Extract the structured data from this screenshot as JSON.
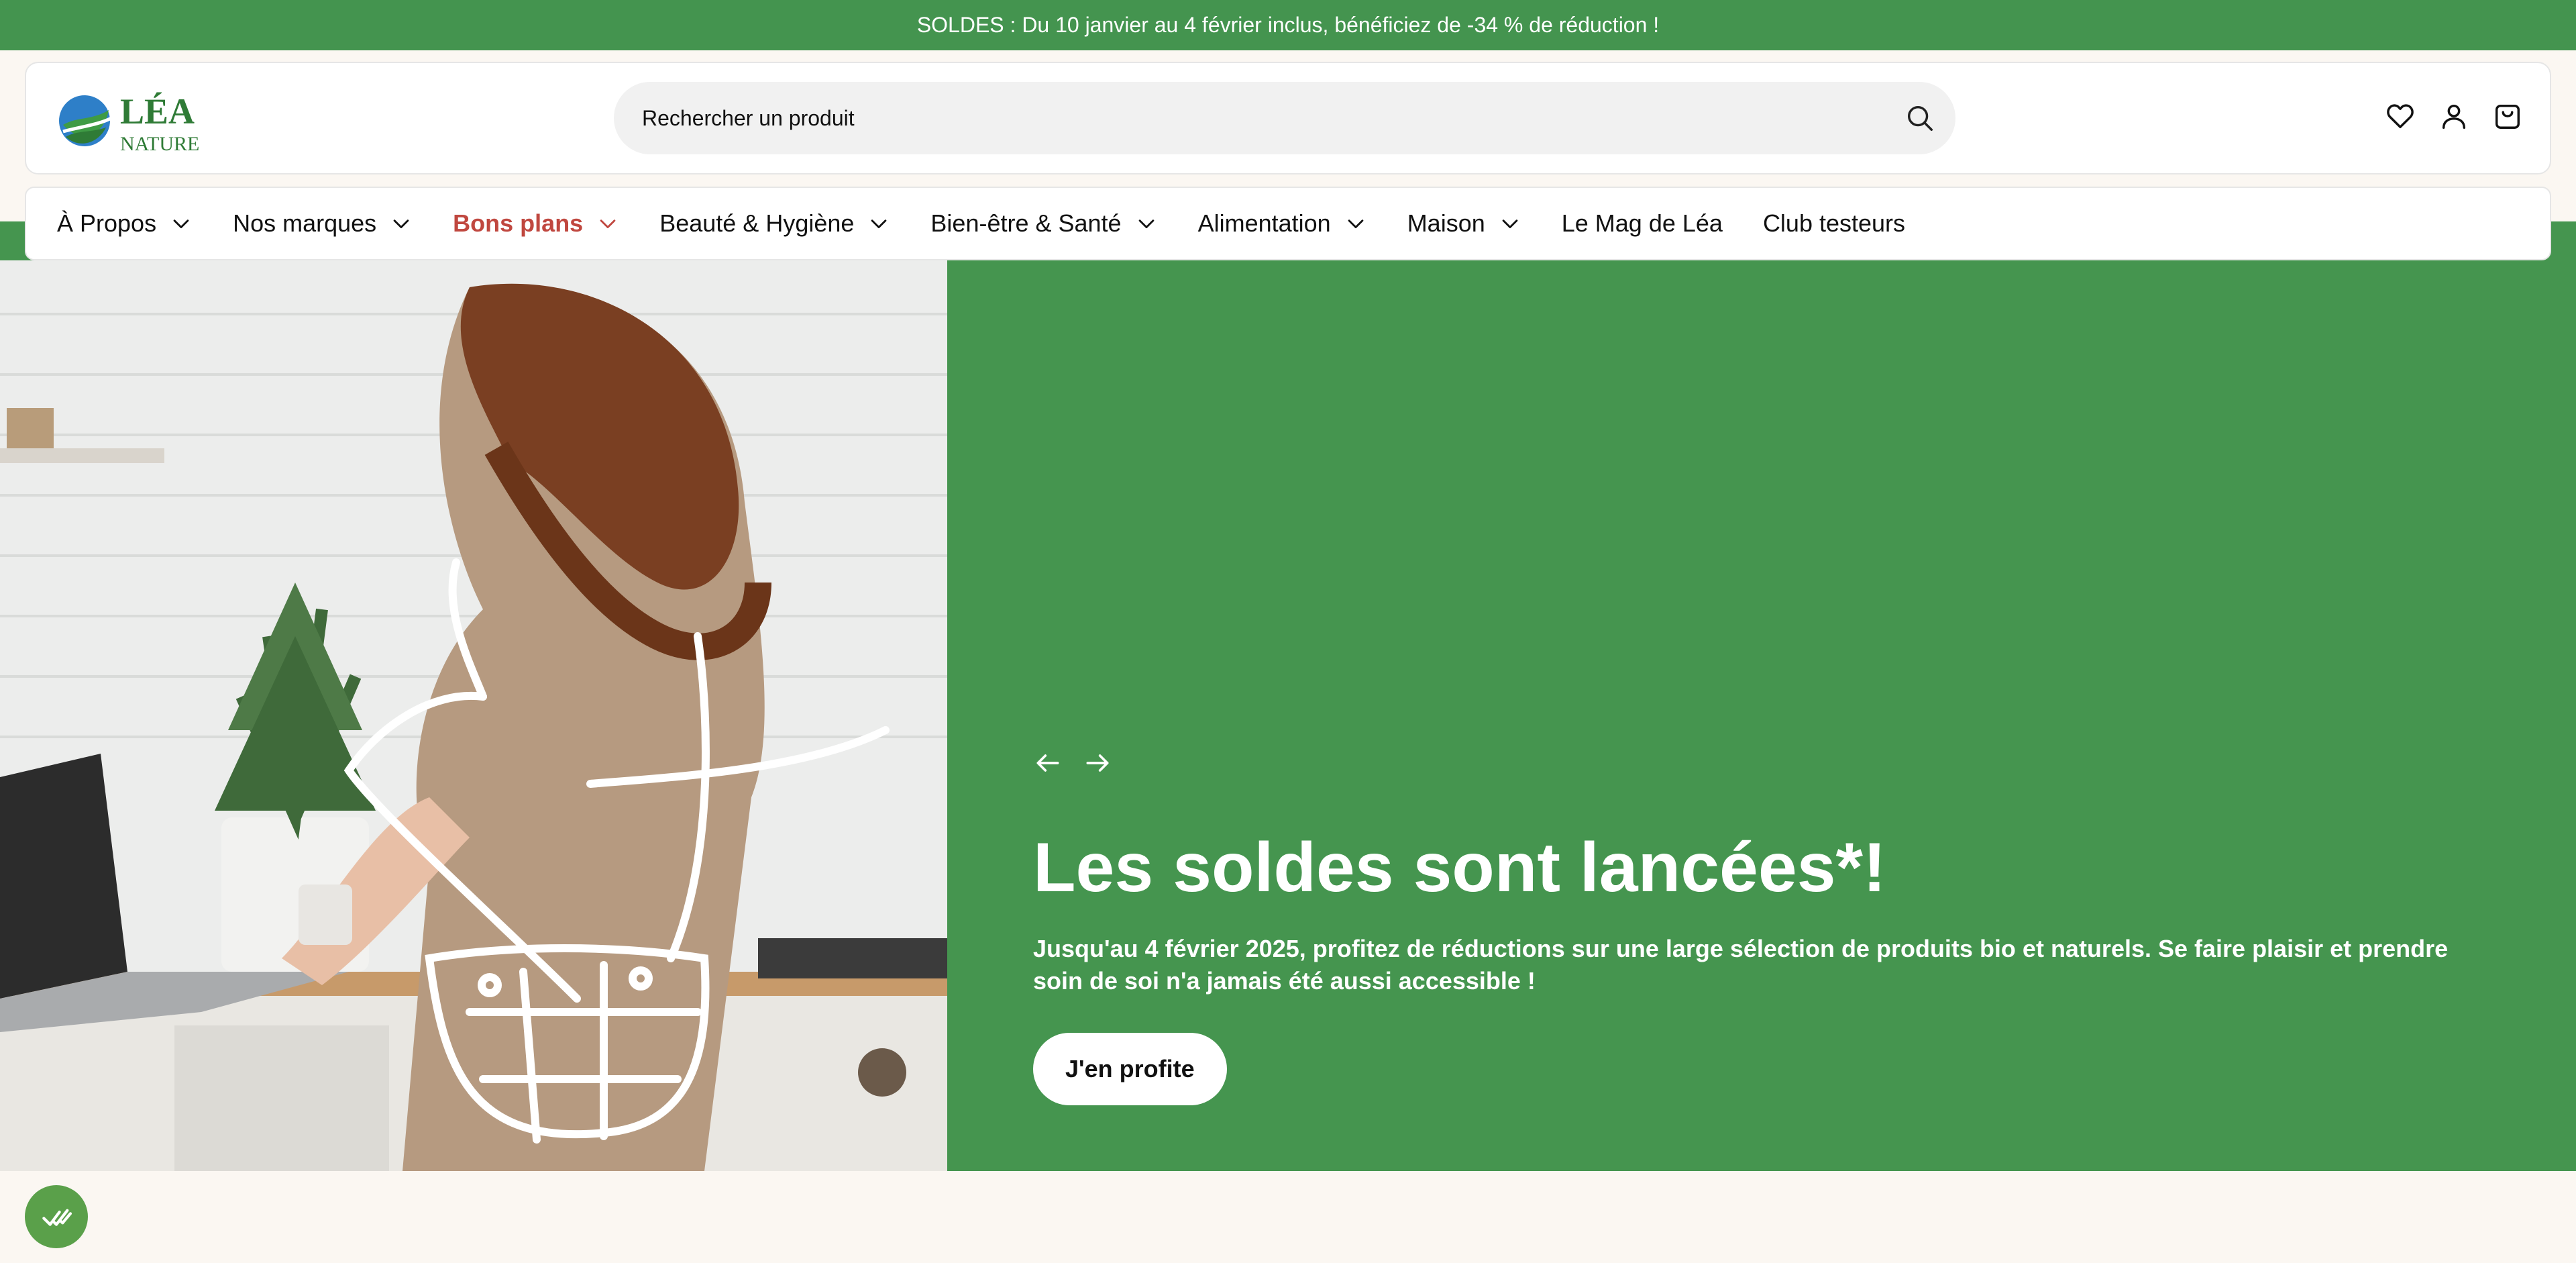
{
  "promo": {
    "text": "SOLDES : Du 10 janvier au 4 février inclus, bénéficiez de -34 % de réduction !"
  },
  "brand": {
    "name_top": "LÉA",
    "name_bottom": "NATURE",
    "primary_color": "#45954f",
    "accent_color": "#c0473f"
  },
  "search": {
    "placeholder": "Rechercher un produit",
    "value": ""
  },
  "header_icons": [
    "heart-icon",
    "user-icon",
    "bag-icon"
  ],
  "nav": {
    "items": [
      {
        "label": "À Propos",
        "dropdown": true
      },
      {
        "label": "Nos marques",
        "dropdown": true
      },
      {
        "label": "Bons plans",
        "dropdown": true,
        "highlight": true
      },
      {
        "label": "Beauté & Hygiène",
        "dropdown": true
      },
      {
        "label": "Bien-être & Santé",
        "dropdown": true
      },
      {
        "label": "Alimentation",
        "dropdown": true
      },
      {
        "label": "Maison",
        "dropdown": true
      },
      {
        "label": "Le Mag de Léa",
        "dropdown": false
      },
      {
        "label": "Club testeurs",
        "dropdown": false
      }
    ]
  },
  "hero": {
    "title": "Les soldes sont lancées*!",
    "subtitle": "Jusqu'au 4 février 2025, profitez de réductions sur une large sélection de produits bio et naturels. Se faire plaisir et prendre soin de soi n'a jamais été aussi accessible !",
    "cta_label": "J'en profite"
  }
}
